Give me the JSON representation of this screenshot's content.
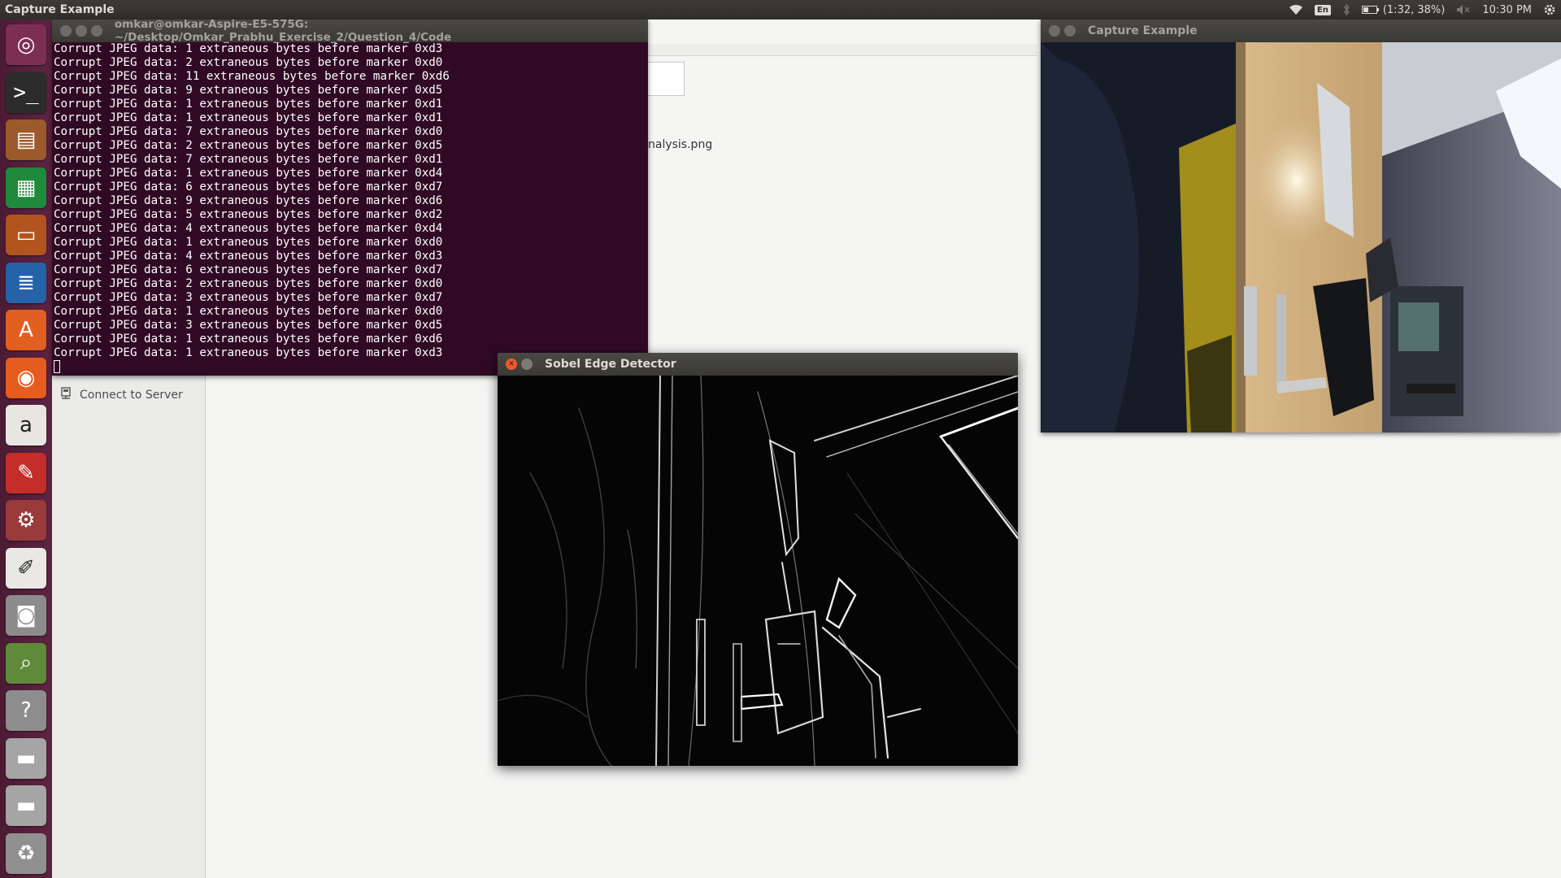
{
  "top_panel": {
    "app_title": "Capture Example",
    "keyboard_layout": "En",
    "battery": "(1:32, 38%)",
    "time": "10:30 PM",
    "icons": [
      "wifi-icon",
      "bluetooth-icon",
      "battery-icon",
      "volume-muted-icon",
      "gear-icon"
    ]
  },
  "launcher": {
    "items": [
      {
        "name": "ubuntu-dash-icon",
        "bg": "#7d2f53"
      },
      {
        "name": "terminal-icon",
        "bg": "#2c2c2c"
      },
      {
        "name": "files-icon",
        "bg": "#9c5a2c"
      },
      {
        "name": "libreoffice-calc-icon",
        "bg": "#1f8a3c"
      },
      {
        "name": "libreoffice-impress-icon",
        "bg": "#b2541d"
      },
      {
        "name": "libreoffice-writer-icon",
        "bg": "#2563a8"
      },
      {
        "name": "ubuntu-software-icon",
        "bg": "#e15f21"
      },
      {
        "name": "firefox-icon",
        "bg": "#e65c1f"
      },
      {
        "name": "amazon-icon",
        "bg": "#e8e6e1"
      },
      {
        "name": "pdf-viewer-icon",
        "bg": "#c42d28"
      },
      {
        "name": "system-settings-icon",
        "bg": "#9a3a3a"
      },
      {
        "name": "text-editor-icon",
        "bg": "#e9e8e4"
      },
      {
        "name": "camera-icon",
        "bg": "#8c8c8c"
      },
      {
        "name": "image-viewer-icon",
        "bg": "#5f8a3a"
      },
      {
        "name": "help-icon",
        "bg": "#8d8d8d"
      },
      {
        "name": "drive-icon",
        "bg": "#a5a5a5"
      },
      {
        "name": "drive-icon-2",
        "bg": "#a5a5a5"
      },
      {
        "name": "trash-icon",
        "bg": "#909090"
      }
    ]
  },
  "files": {
    "connect_label": "Connect to Server",
    "file_name": "nalysis.png"
  },
  "terminal": {
    "title": "omkar@omkar-Aspire-E5-575G: ~/Desktop/Omkar_Prabhu_Exercise_2/Question_4/Code",
    "lines": [
      "Corrupt JPEG data: 1 extraneous bytes before marker 0xd3",
      "Corrupt JPEG data: 2 extraneous bytes before marker 0xd0",
      "Corrupt JPEG data: 11 extraneous bytes before marker 0xd6",
      "Corrupt JPEG data: 9 extraneous bytes before marker 0xd5",
      "Corrupt JPEG data: 1 extraneous bytes before marker 0xd1",
      "Corrupt JPEG data: 1 extraneous bytes before marker 0xd1",
      "Corrupt JPEG data: 7 extraneous bytes before marker 0xd0",
      "Corrupt JPEG data: 2 extraneous bytes before marker 0xd5",
      "Corrupt JPEG data: 7 extraneous bytes before marker 0xd1",
      "Corrupt JPEG data: 1 extraneous bytes before marker 0xd4",
      "Corrupt JPEG data: 6 extraneous bytes before marker 0xd7",
      "Corrupt JPEG data: 9 extraneous bytes before marker 0xd6",
      "Corrupt JPEG data: 5 extraneous bytes before marker 0xd2",
      "Corrupt JPEG data: 4 extraneous bytes before marker 0xd4",
      "Corrupt JPEG data: 1 extraneous bytes before marker 0xd0",
      "Corrupt JPEG data: 4 extraneous bytes before marker 0xd3",
      "Corrupt JPEG data: 6 extraneous bytes before marker 0xd7",
      "Corrupt JPEG data: 2 extraneous bytes before marker 0xd0",
      "Corrupt JPEG data: 3 extraneous bytes before marker 0xd7",
      "Corrupt JPEG data: 1 extraneous bytes before marker 0xd0",
      "Corrupt JPEG data: 3 extraneous bytes before marker 0xd5",
      "Corrupt JPEG data: 1 extraneous bytes before marker 0xd6",
      "Corrupt JPEG data: 1 extraneous bytes before marker 0xd3"
    ]
  },
  "capture_window": {
    "title": "Capture Example"
  },
  "sobel_window": {
    "title": "Sobel Edge Detector"
  }
}
